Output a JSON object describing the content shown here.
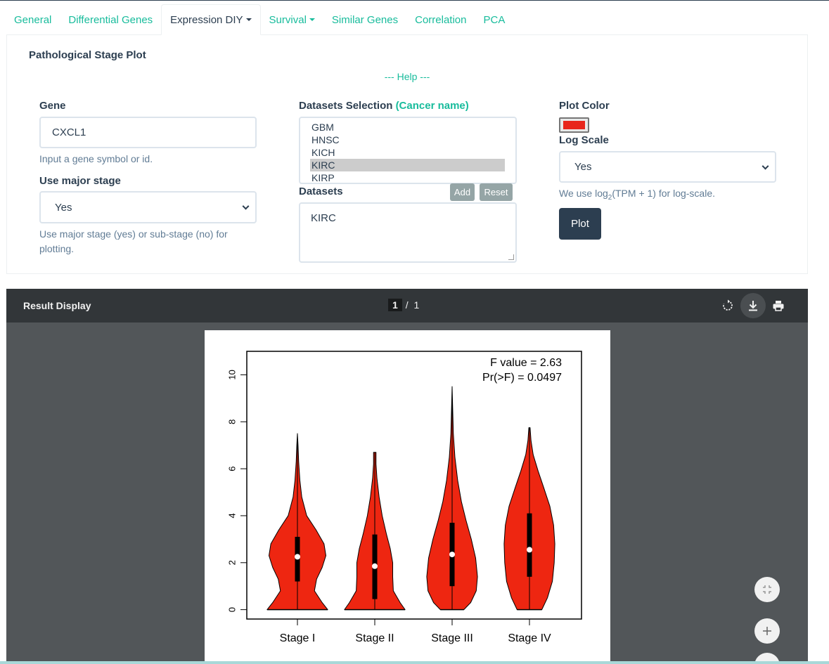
{
  "tabs": [
    {
      "label": "General",
      "dropdown": false
    },
    {
      "label": "Differential Genes",
      "dropdown": false
    },
    {
      "label": "Expression DIY",
      "dropdown": true,
      "active": true
    },
    {
      "label": "Survival",
      "dropdown": true
    },
    {
      "label": "Similar Genes",
      "dropdown": false
    },
    {
      "label": "Correlation",
      "dropdown": false
    },
    {
      "label": "PCA",
      "dropdown": false
    }
  ],
  "panel": {
    "title": "Pathological Stage Plot",
    "help": "--- Help ---",
    "gene": {
      "label": "Gene",
      "value": "CXCL1",
      "hint": "Input a gene symbol or id."
    },
    "major_stage": {
      "label": "Use major stage",
      "value": "Yes",
      "hint": "Use major stage (yes) or sub-stage (no) for plotting."
    },
    "datasets_selection": {
      "label": "Datasets Selection",
      "label_accent": "(Cancer name)",
      "options": [
        "GBM",
        "HNSC",
        "KICH",
        "KIRC",
        "KIRP"
      ],
      "selected": "KIRC"
    },
    "datasets": {
      "label": "Datasets",
      "add": "Add",
      "reset": "Reset",
      "value": "KIRC"
    },
    "plot_color": {
      "label": "Plot Color",
      "value": "#e8251b"
    },
    "log_scale": {
      "label": "Log Scale",
      "value": "Yes",
      "hint_pre": "We use log",
      "hint_sub": "2",
      "hint_post": "(TPM + 1) for log-scale."
    },
    "plot_button": "Plot"
  },
  "result": {
    "title": "Result Display",
    "page_current": "1",
    "page_sep": "/",
    "page_total": "1",
    "icons": {
      "rotate": "rotate-icon",
      "download": "download-icon",
      "print": "print-icon",
      "fit": "fit-page-icon",
      "zoom_in": "zoom-in-icon"
    }
  },
  "chart_data": {
    "type": "violin",
    "categories": [
      "Stage I",
      "Stage II",
      "Stage III",
      "Stage IV"
    ],
    "ylim": [
      -0.4,
      11.0
    ],
    "yticks": [
      0,
      2,
      4,
      6,
      8,
      10
    ],
    "annotations": [
      "F value = 2.63",
      "Pr(>F) = 0.0497"
    ],
    "fill_color": "#ee2611",
    "violins": [
      {
        "name": "Stage I",
        "max": 7.5,
        "median": 2.25,
        "q1": 1.2,
        "q3": 3.1,
        "profile": [
          [
            0,
            0.98
          ],
          [
            0.3,
            0.8
          ],
          [
            0.8,
            0.55
          ],
          [
            1.3,
            0.62
          ],
          [
            1.8,
            0.8
          ],
          [
            2.3,
            0.92
          ],
          [
            2.8,
            0.86
          ],
          [
            3.4,
            0.6
          ],
          [
            4.0,
            0.3
          ],
          [
            4.8,
            0.14
          ],
          [
            5.5,
            0.08
          ],
          [
            6.3,
            0.04
          ],
          [
            7.0,
            0.02
          ],
          [
            7.5,
            0.0
          ]
        ]
      },
      {
        "name": "Stage II",
        "max": 6.7,
        "median": 1.85,
        "q1": 0.45,
        "q3": 3.2,
        "profile": [
          [
            0,
            0.98
          ],
          [
            0.3,
            0.82
          ],
          [
            0.8,
            0.6
          ],
          [
            1.4,
            0.58
          ],
          [
            2.0,
            0.58
          ],
          [
            2.6,
            0.5
          ],
          [
            3.2,
            0.38
          ],
          [
            4.0,
            0.24
          ],
          [
            4.8,
            0.14
          ],
          [
            5.6,
            0.07
          ],
          [
            6.2,
            0.04
          ],
          [
            6.7,
            0.04
          ]
        ]
      },
      {
        "name": "Stage III",
        "max": 9.5,
        "median": 2.35,
        "q1": 1.0,
        "q3": 3.7,
        "profile": [
          [
            0,
            0.38
          ],
          [
            0.3,
            0.6
          ],
          [
            0.8,
            0.78
          ],
          [
            1.4,
            0.82
          ],
          [
            2.2,
            0.76
          ],
          [
            3.0,
            0.62
          ],
          [
            3.8,
            0.45
          ],
          [
            4.6,
            0.3
          ],
          [
            5.5,
            0.18
          ],
          [
            6.5,
            0.09
          ],
          [
            7.5,
            0.04
          ],
          [
            8.5,
            0.02
          ],
          [
            9.5,
            0.0
          ]
        ]
      },
      {
        "name": "Stage IV",
        "max": 7.75,
        "median": 2.55,
        "q1": 1.4,
        "q3": 4.1,
        "profile": [
          [
            0,
            0.4
          ],
          [
            0.5,
            0.58
          ],
          [
            1.2,
            0.74
          ],
          [
            2.0,
            0.8
          ],
          [
            2.8,
            0.82
          ],
          [
            3.6,
            0.78
          ],
          [
            4.4,
            0.66
          ],
          [
            5.2,
            0.46
          ],
          [
            5.9,
            0.28
          ],
          [
            6.6,
            0.12
          ],
          [
            7.2,
            0.05
          ],
          [
            7.75,
            0.02
          ]
        ]
      }
    ]
  }
}
